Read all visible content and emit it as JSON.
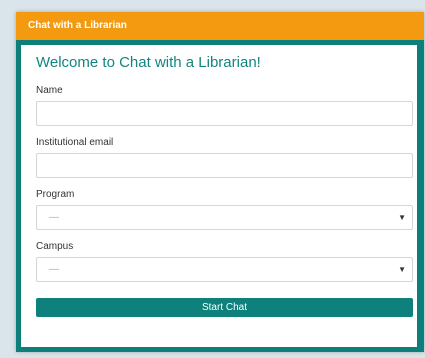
{
  "widget": {
    "header_title": "Chat with a Librarian",
    "welcome": "Welcome to Chat with a Librarian!"
  },
  "form": {
    "name_label": "Name",
    "email_label": "Institutional email",
    "program_label": "Program",
    "program_value": "—",
    "campus_label": "Campus",
    "campus_value": "—",
    "start_button": "Start Chat"
  },
  "colors": {
    "header": "#f39a10",
    "teal": "#0d7f7a",
    "background": "#d9e5ea"
  }
}
